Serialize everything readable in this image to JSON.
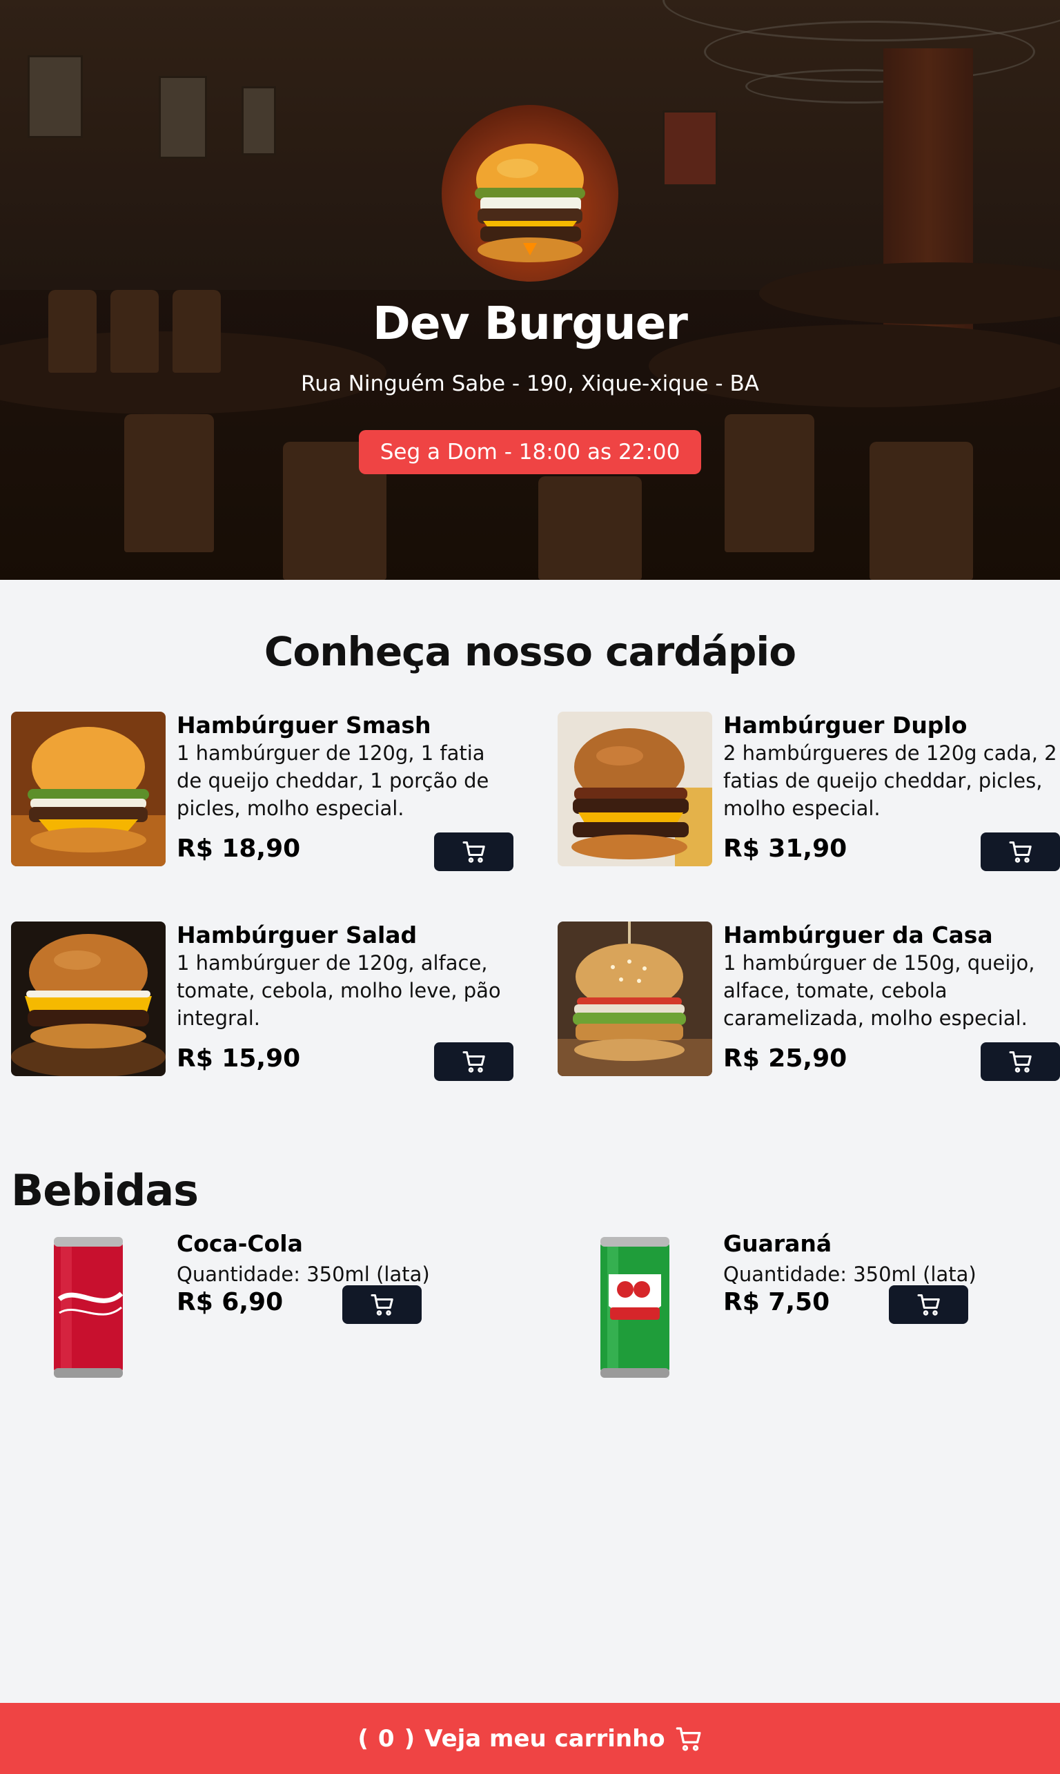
{
  "header": {
    "title": "Dev Burguer",
    "address": "Rua Ninguém Sabe - 190, Xique-xique - BA",
    "hours": "Seg a Dom - 18:00 as 22:00"
  },
  "menu": {
    "title": "Conheça nosso cardápio",
    "items": [
      {
        "name": "Hambúrguer Smash",
        "description": "1 hambúrguer de 120g, 1 fatia de queijo cheddar, 1 porção de picles, molho especial.",
        "price": "R$ 18,90"
      },
      {
        "name": "Hambúrguer Duplo",
        "description": "2 hambúrgueres de 120g cada, 2 fatias de queijo cheddar, picles, molho especial.",
        "price": "R$ 31,90"
      },
      {
        "name": "Hambúrguer Salad",
        "description": "1 hambúrguer de 120g, alface, tomate, cebola, molho leve, pão integral.",
        "price": "R$ 15,90"
      },
      {
        "name": "Hambúrguer da Casa",
        "description": "1 hambúrguer de 150g, queijo, alface, tomate, cebola caramelizada, molho especial.",
        "price": "R$ 25,90"
      }
    ]
  },
  "drinks": {
    "title": "Bebidas",
    "items": [
      {
        "name": "Coca-Cola",
        "description": "Quantidade: 350ml (lata)",
        "price": "R$ 6,90",
        "can_color": "#c8102e"
      },
      {
        "name": "Guaraná",
        "description": "Quantidade: 350ml (lata)",
        "price": "R$ 7,50",
        "can_color": "#1f9d3a"
      }
    ]
  },
  "cart": {
    "open_paren": "(",
    "count": "0",
    "close_paren": ")",
    "label": "Veja meu carrinho",
    "icon": "cart-icon"
  },
  "colors": {
    "accent": "#ef4444",
    "button_dark": "#111827",
    "background": "#f3f4f6"
  }
}
